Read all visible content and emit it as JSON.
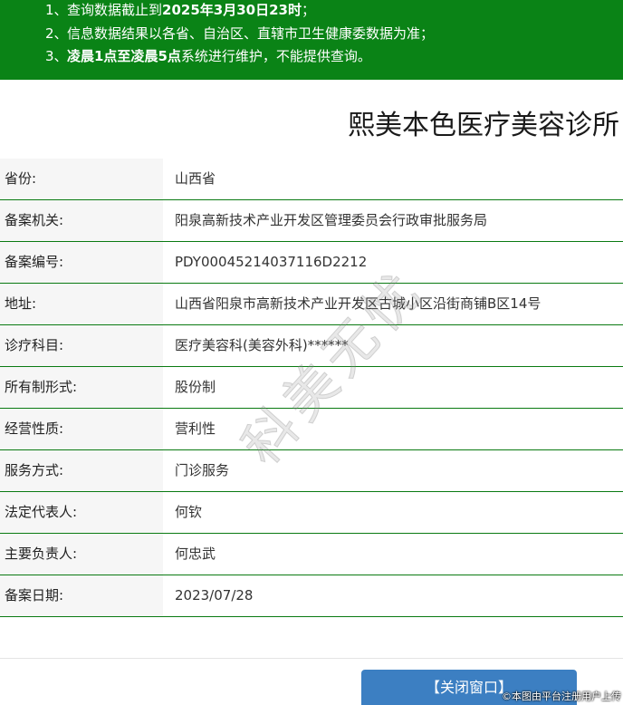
{
  "notice": {
    "line1": {
      "num": "1、",
      "pre": "查询数据截止到",
      "bold": "2025年3月30日23时",
      "post": "；"
    },
    "line2": {
      "num": "2、",
      "text": "信息数据结果以各省、自治区、直辖市卫生健康委数据为准；"
    },
    "line3": {
      "num": "3、",
      "bold": "凌晨1点至凌晨5点",
      "post": "系统进行维护，不能提供查询。"
    }
  },
  "title": "熙美本色医疗美容诊所",
  "info": [
    {
      "label": "省份:",
      "value": "山西省"
    },
    {
      "label": "备案机关:",
      "value": "阳泉高新技术产业开发区管理委员会行政审批服务局"
    },
    {
      "label": "备案编号:",
      "value": "PDY00045214037116D2212"
    },
    {
      "label": "地址:",
      "value": "山西省阳泉市高新技术产业开发区古城小区沿街商铺B区14号"
    },
    {
      "label": "诊疗科目:",
      "value": "医疗美容科(美容外科)******"
    },
    {
      "label": "所有制形式:",
      "value": "股份制"
    },
    {
      "label": "经营性质:",
      "value": "营利性"
    },
    {
      "label": "服务方式:",
      "value": "门诊服务"
    },
    {
      "label": "法定代表人:",
      "value": "何钦"
    },
    {
      "label": "主要负责人:",
      "value": "何忠武"
    },
    {
      "label": "备案日期:",
      "value": "2023/07/28"
    }
  ],
  "close_button": "【关闭窗口】",
  "watermark": "科美无忧",
  "credit": "©本图由平台注册用户上传",
  "colors": {
    "notice_bg": "#0a8316",
    "row_border": "#0a7a12",
    "button_bg": "#3c7fc2"
  }
}
